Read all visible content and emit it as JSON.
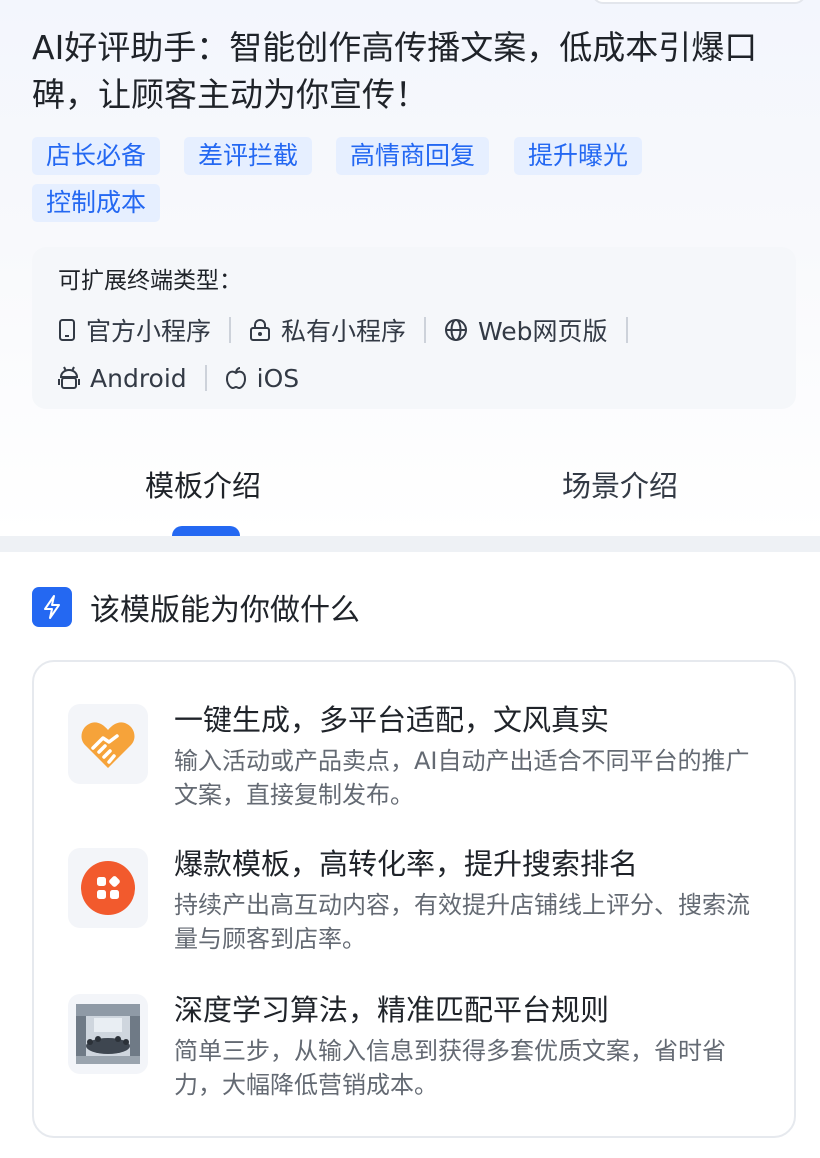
{
  "header": {
    "title": "AI好评助手：智能创作高传播文案，低成本引爆口碑，让顾客主动为你宣传！",
    "tags": [
      "店长必备",
      "差评拦截",
      "高情商回复",
      "提升曝光",
      "控制成本"
    ]
  },
  "terminals": {
    "label": "可扩展终端类型：",
    "items": [
      {
        "label": "官方小程序",
        "icon": "mobile-icon"
      },
      {
        "label": "私有小程序",
        "icon": "lock-icon"
      },
      {
        "label": "Web网页版",
        "icon": "globe-icon"
      },
      {
        "label": "Android",
        "icon": "android-icon"
      },
      {
        "label": "iOS",
        "icon": "apple-icon"
      }
    ]
  },
  "tabs": [
    {
      "label": "模板介绍",
      "active": true
    },
    {
      "label": "场景介绍",
      "active": false
    }
  ],
  "section": {
    "title": "该模版能为你做什么",
    "icon": "lightning-icon"
  },
  "features": [
    {
      "title": "一键生成，多平台适配，文风真实",
      "desc": "输入活动或产品卖点，AI自动产出适合不同平台的推广文案，直接复制发布。",
      "icon": "handshake-icon"
    },
    {
      "title": "爆款模板，高转化率，提升搜索排名",
      "desc": "持续产出高互动内容，有效提升店铺线上评分、搜索流量与顾客到店率。",
      "icon": "apps-icon"
    },
    {
      "title": "深度学习算法，精准匹配平台规则",
      "desc": "简单三步，从输入信息到获得多套优质文案，省时省力，大幅降低营销成本。",
      "icon": "meeting-room-photo"
    }
  ],
  "colors": {
    "accent": "#2468f2",
    "tag_bg": "#e6efff",
    "handshake": "#f6a33a",
    "apps": "#f25a2d"
  }
}
